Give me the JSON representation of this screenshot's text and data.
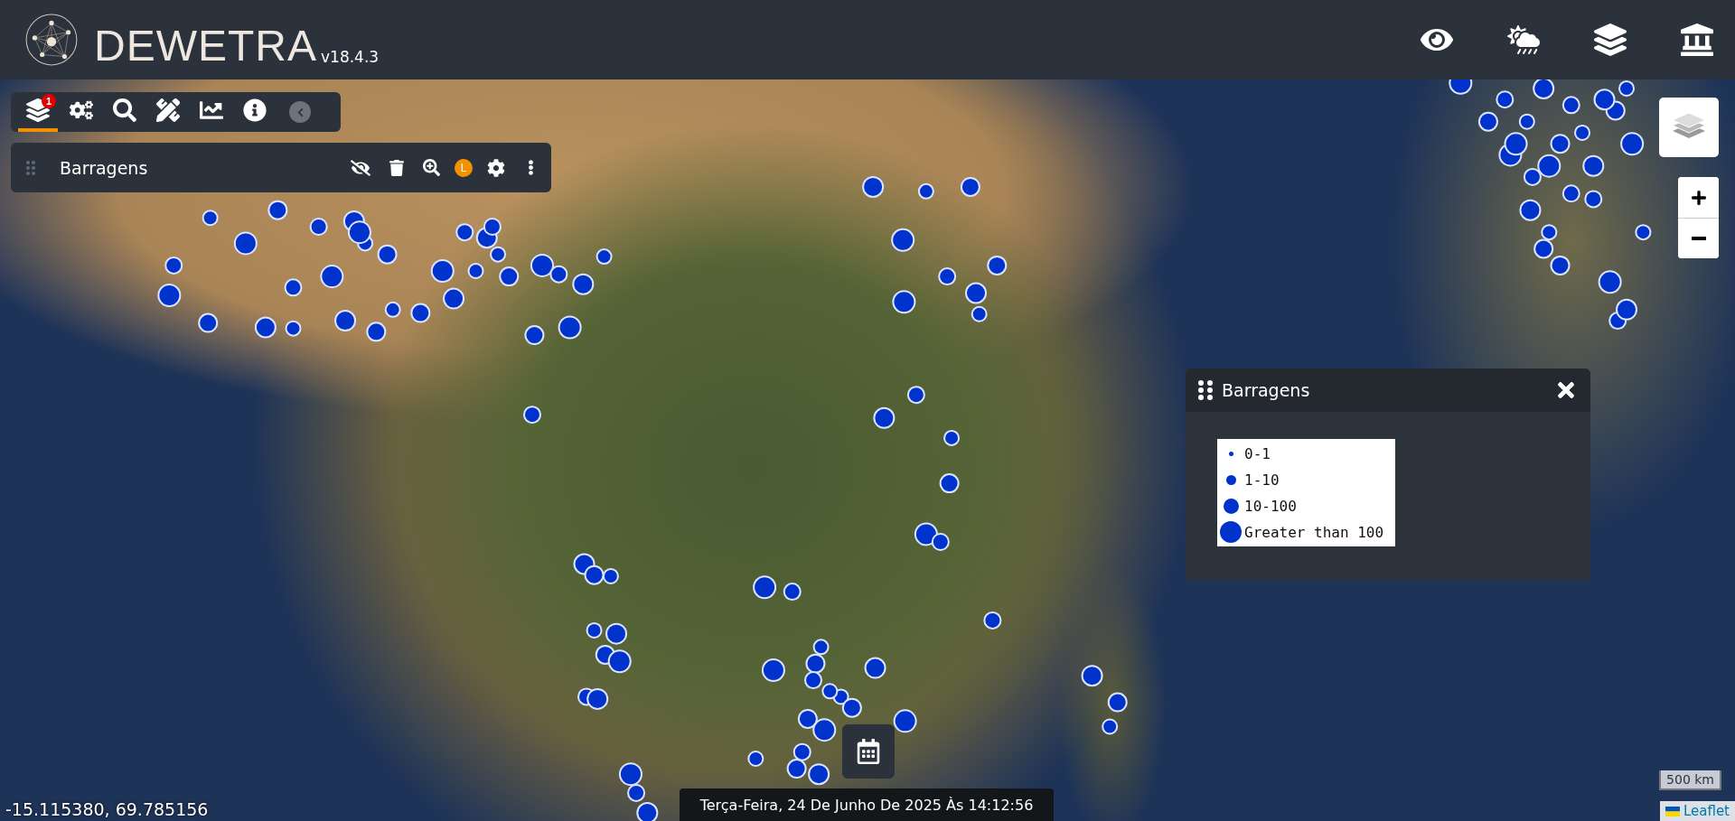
{
  "header": {
    "title": "DEWETRA",
    "version": "v18.4.3",
    "icons": [
      {
        "kind": "eye"
      },
      {
        "kind": "weather"
      },
      {
        "kind": "layers"
      },
      {
        "kind": "institution"
      }
    ]
  },
  "toolbar": {
    "tabs": [
      {
        "kind": "layers",
        "badge": "1",
        "selected": true
      },
      {
        "kind": "settings",
        "selected": false
      },
      {
        "kind": "search",
        "selected": false
      },
      {
        "kind": "draw",
        "selected": false
      },
      {
        "kind": "chart",
        "selected": false
      },
      {
        "kind": "info",
        "selected": false
      }
    ]
  },
  "layer_row": {
    "name": "Barragens",
    "badge": "L"
  },
  "legend": {
    "title": "Barragens",
    "items": [
      {
        "label": "0-1"
      },
      {
        "label": "1-10"
      },
      {
        "label": "10-100"
      },
      {
        "label": "Greater than 100"
      }
    ]
  },
  "coordinates": "-15.115380, 69.785156",
  "date": "Terça-Feira, 24 De Junho De 2025 Às 14:12:56",
  "scale": "500 km",
  "attribution": "Leaflet"
}
